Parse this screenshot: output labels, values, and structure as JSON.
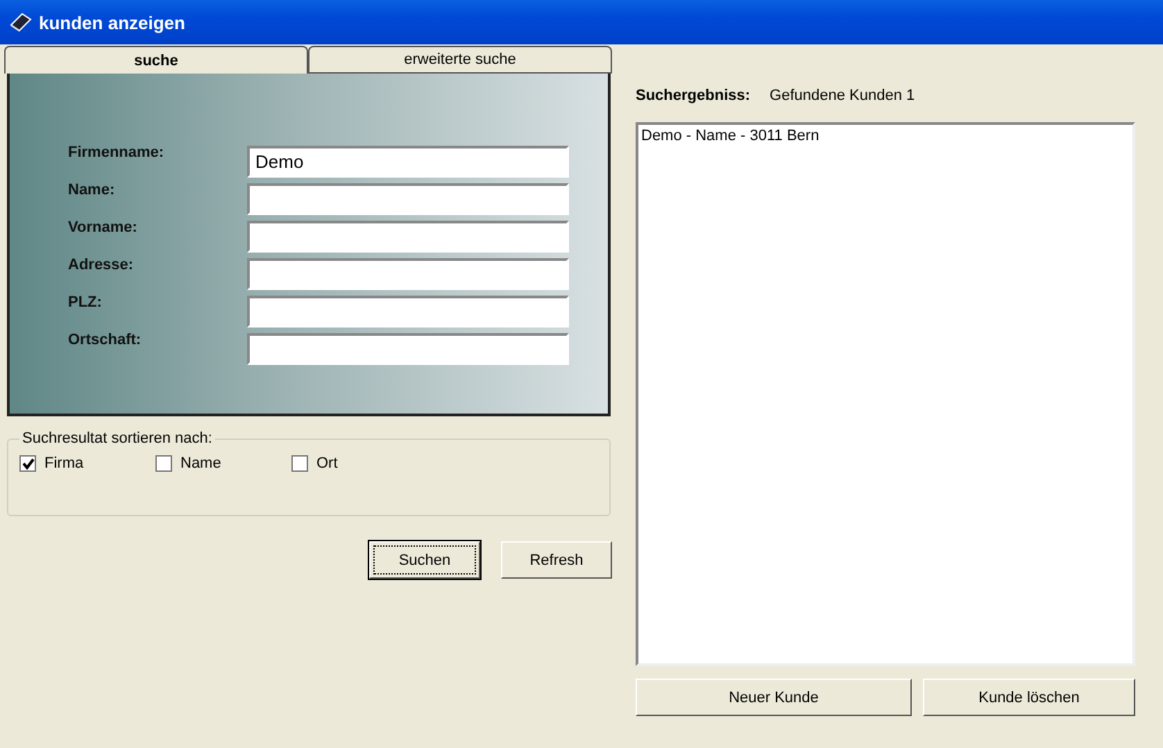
{
  "window": {
    "title": "kunden anzeigen"
  },
  "tabs": [
    {
      "label": "suche",
      "selected": true
    },
    {
      "label": "erweiterte suche",
      "selected": false
    }
  ],
  "fields": [
    {
      "label": "Firmenname:",
      "value": "Demo"
    },
    {
      "label": "Name:"
    },
    {
      "label": "Vorname:"
    },
    {
      "label": "Adresse:"
    },
    {
      "label": "PLZ:"
    },
    {
      "label": "Ortschaft:"
    }
  ],
  "sort_group": {
    "title": "Suchresultat sortieren nach:",
    "options": [
      {
        "label": "Firma",
        "checked": true
      },
      {
        "label": "Name",
        "checked": false
      },
      {
        "label": "Ort",
        "checked": false
      }
    ]
  },
  "search_buttons": [
    {
      "label": "Suchen",
      "focused": true
    },
    {
      "label": "Refresh",
      "focused": false
    }
  ],
  "result": {
    "label": "Suchergebniss:",
    "count_text": "Gefundene Kunden  1",
    "items": [
      "Demo - Name - 3011 Bern"
    ]
  },
  "result_buttons": [
    "Neuer Kunde",
    "Kunde löschen"
  ]
}
